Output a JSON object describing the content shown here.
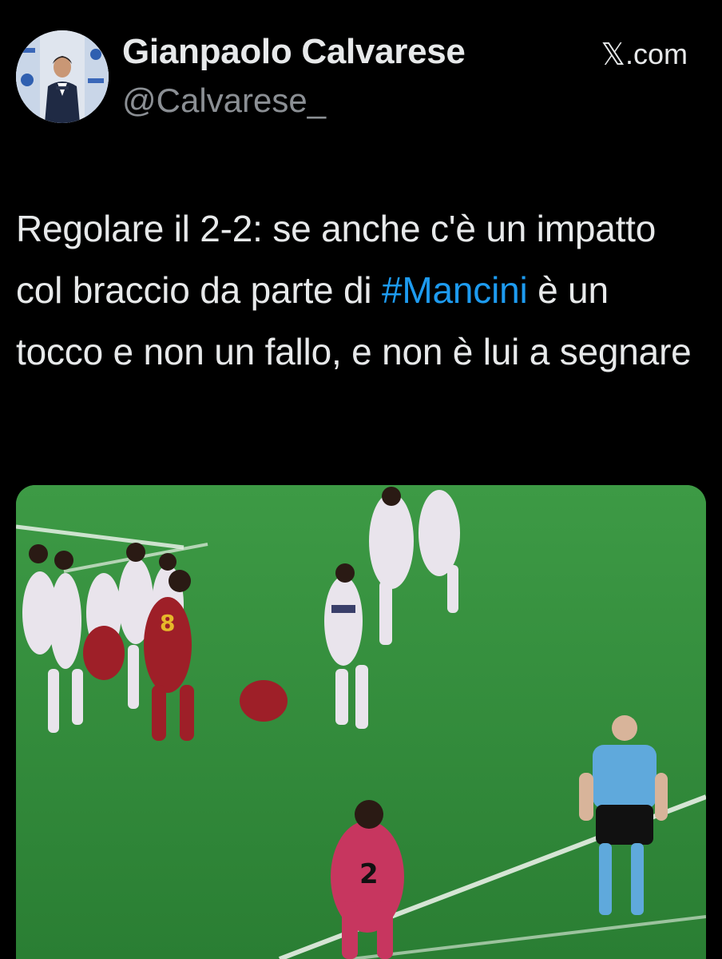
{
  "author": {
    "display_name": "Gianpaolo Calvarese",
    "handle": "@Calvarese_",
    "avatar_icon": "profile-photo"
  },
  "source": {
    "glyph": "𝕏",
    "text": ".com"
  },
  "tweet": {
    "text_before": "Regolare il 2-2: se anche c'è un impatto col braccio da parte di ",
    "hashtag": "#Mancini",
    "text_after": " è un tocco e non un fallo, e non è lui a segnare"
  },
  "media": {
    "type": "video-still",
    "description_icon": "football-match-image",
    "jersey_number_player": "2"
  },
  "colors": {
    "background": "#000000",
    "text": "#e7e9ea",
    "secondary_text": "#8b8f94",
    "link": "#1d9bf0",
    "pitch": "#2f8a3a"
  }
}
